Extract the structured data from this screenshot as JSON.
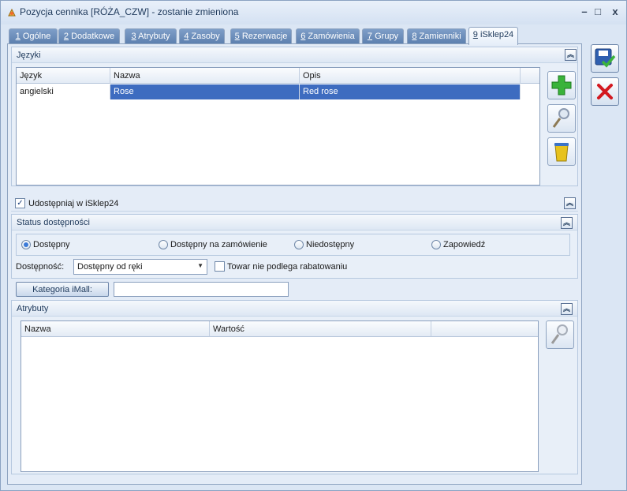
{
  "window": {
    "title": "Pozycja cennika [RÓŻA_CZW] - zostanie zmieniona",
    "minimize_symbol": "–",
    "maximize_symbol": "□",
    "close_symbol": "x"
  },
  "tabs": [
    {
      "num": "1",
      "label": " Ogólne"
    },
    {
      "num": "2",
      "label": " Dodatkowe"
    },
    {
      "num": "3",
      "label": " Atrybuty"
    },
    {
      "num": "4",
      "label": " Zasoby"
    },
    {
      "num": "5",
      "label": " Rezerwacje"
    },
    {
      "num": "6",
      "label": " Zamówienia"
    },
    {
      "num": "7",
      "label": " Grupy"
    },
    {
      "num": "8",
      "label": " Zamienniki"
    },
    {
      "num": "9",
      "label": " iSklep24"
    }
  ],
  "languages": {
    "header": "Języki",
    "columns": [
      "Język",
      "Nazwa",
      "Opis"
    ],
    "rows": [
      {
        "jezyk": "angielski",
        "nazwa": "Rose",
        "opis": "Red rose"
      }
    ]
  },
  "share": {
    "label": "Udostępniaj w iSklep24",
    "checked": true
  },
  "availability": {
    "header": "Status dostępności",
    "options": [
      "Dostępny",
      "Dostępny na zamówienie",
      "Niedostępny",
      "Zapowiedź"
    ],
    "selected": "Dostępny",
    "dostepnosc_label": "Dostępność:",
    "dostepnosc_value": "Dostępny od ręki",
    "discount_label": "Towar nie podlega rabatowaniu",
    "discount_checked": false
  },
  "category": {
    "button_label": "Kategoria iMall:",
    "value": ""
  },
  "attributes": {
    "header": "Atrybuty",
    "columns": [
      "Nazwa",
      "Wartość",
      ""
    ]
  },
  "icons": {
    "add": "plus-icon",
    "edit": "magnifier-icon",
    "delete": "trash-icon",
    "save": "save-icon",
    "cancel": "cancel-icon"
  }
}
